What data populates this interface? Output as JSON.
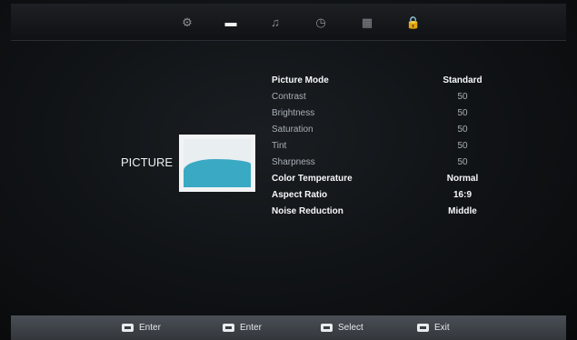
{
  "topbar": {
    "tabs": [
      {
        "icon": "gear-icon",
        "glyph": "⚙",
        "active": false
      },
      {
        "icon": "monitor-icon",
        "glyph": "▬",
        "active": true
      },
      {
        "icon": "music-note-icon",
        "glyph": "♫",
        "active": false
      },
      {
        "icon": "clock-icon",
        "glyph": "◷",
        "active": false
      },
      {
        "icon": "grid-icon",
        "glyph": "▦",
        "active": false
      },
      {
        "icon": "lock-icon",
        "glyph": "🔒",
        "active": false
      }
    ]
  },
  "category": {
    "title": "PICTURE"
  },
  "settings": [
    {
      "label": "Picture Mode",
      "value": "Standard",
      "style": "main"
    },
    {
      "label": "Contrast",
      "value": "50",
      "style": "sub"
    },
    {
      "label": "Brightness",
      "value": "50",
      "style": "sub"
    },
    {
      "label": "Saturation",
      "value": "50",
      "style": "sub"
    },
    {
      "label": "Tint",
      "value": "50",
      "style": "sub"
    },
    {
      "label": "Sharpness",
      "value": "50",
      "style": "sub"
    },
    {
      "label": "Color Temperature",
      "value": "Normal",
      "style": "main"
    },
    {
      "label": "Aspect Ratio",
      "value": "16:9",
      "style": "main"
    },
    {
      "label": "Noise Reduction",
      "value": "Middle",
      "style": "main"
    }
  ],
  "bottombar": {
    "hints": [
      {
        "label": "Enter"
      },
      {
        "label": "Enter"
      },
      {
        "label": "Select"
      },
      {
        "label": "Exit"
      }
    ]
  }
}
